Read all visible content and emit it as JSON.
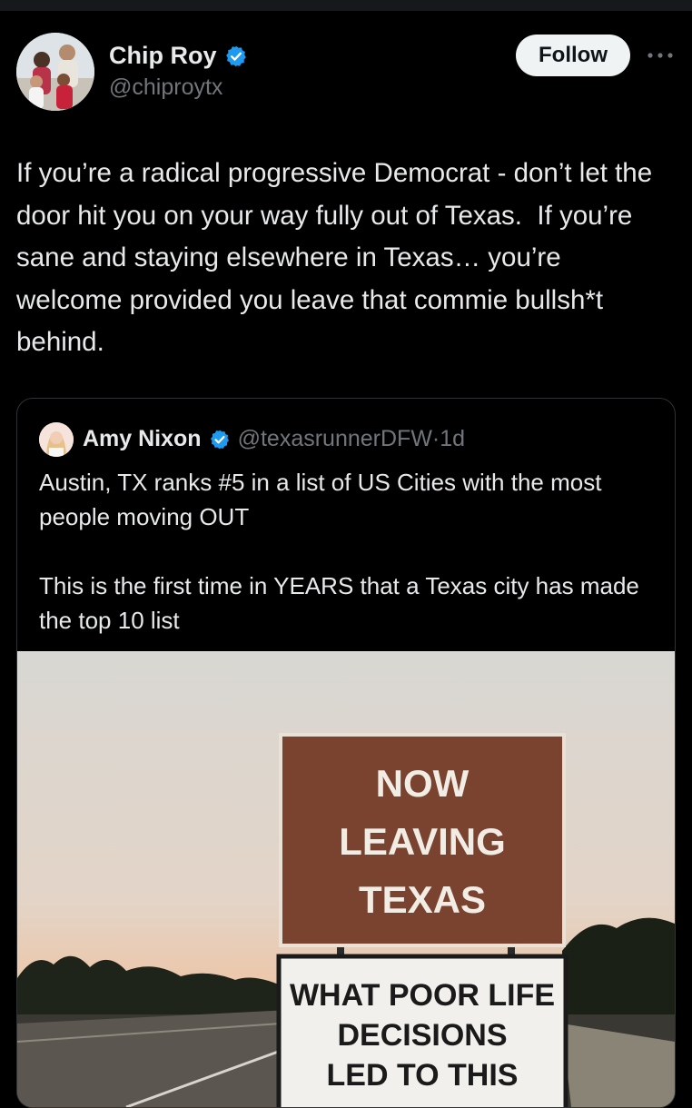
{
  "tweet": {
    "author": {
      "name": "Chip Roy",
      "handle": "@chiproytx",
      "verified": true,
      "avatar_icon": "family-photo-avatar"
    },
    "follow_label": "Follow",
    "more_icon": "more-horizontal-icon",
    "text": "If you’re a radical progressive Democrat - don’t let the door hit you on your way fully out of Texas.  If you’re sane and staying elsewhere in Texas… you’re welcome provided you leave that commie bullsh*t behind."
  },
  "quote": {
    "author": {
      "name": "Amy Nixon",
      "handle": "@texasrunnerDFW",
      "separator": "·",
      "time": "1d",
      "verified": true
    },
    "text": "Austin, TX ranks #5 in a list of US Cities with the most people moving OUT\n\nThis is the first time in YEARS that a Texas city has made the top 10 list",
    "image": {
      "sign_top": [
        "NOW",
        "LEAVING",
        "TEXAS"
      ],
      "sign_bottom": [
        "WHAT POOR LIFE",
        "DECISIONS",
        "LED TO THIS"
      ]
    }
  },
  "colors": {
    "background": "#000000",
    "text": "#e7e9ea",
    "muted": "#71767b",
    "verified_blue": "#1d9bf0",
    "border": "#2f3336",
    "sign_brown": "#7a4330"
  }
}
